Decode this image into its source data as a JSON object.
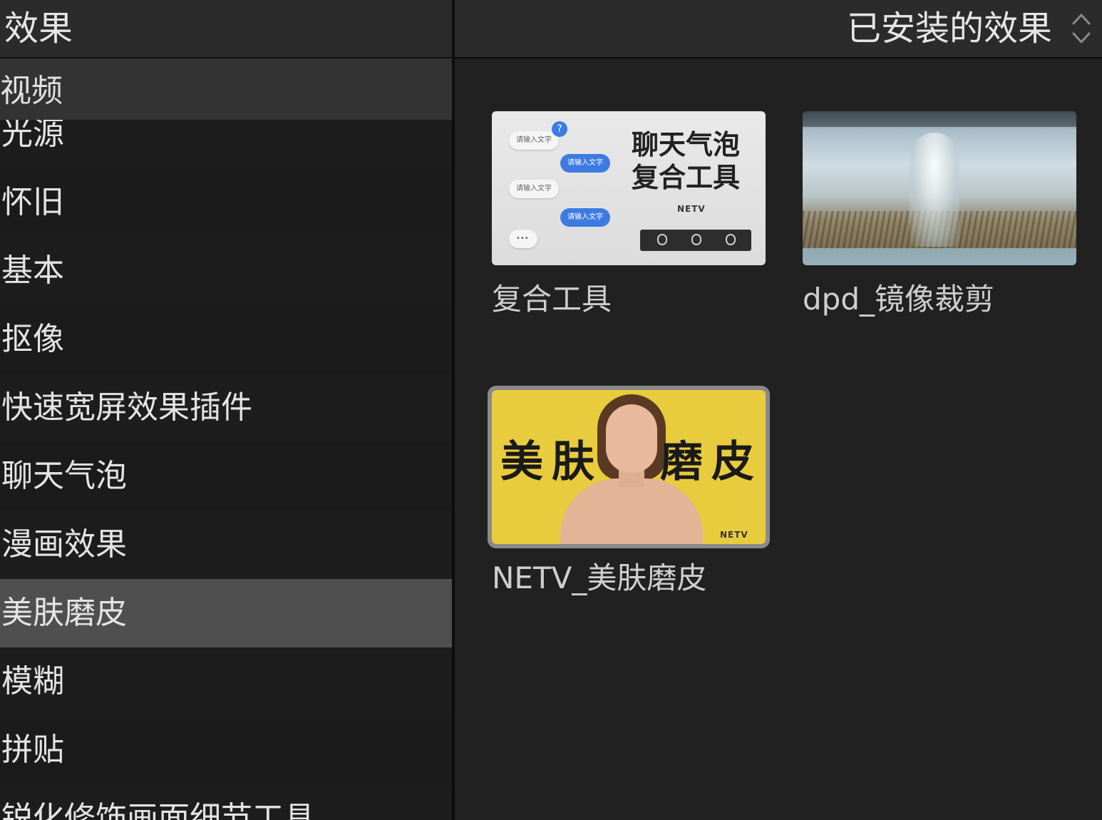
{
  "sidebar": {
    "title": "效果",
    "section": "视频",
    "categories": [
      {
        "label": "光源",
        "selected": false
      },
      {
        "label": "怀旧",
        "selected": false
      },
      {
        "label": "基本",
        "selected": false
      },
      {
        "label": "抠像",
        "selected": false
      },
      {
        "label": "快速宽屏效果插件",
        "selected": false
      },
      {
        "label": "聊天气泡",
        "selected": false
      },
      {
        "label": "漫画效果",
        "selected": false
      },
      {
        "label": "美肤磨皮",
        "selected": true
      },
      {
        "label": "模糊",
        "selected": false
      },
      {
        "label": "拼贴",
        "selected": false
      },
      {
        "label": "锐化修饰画面细节工具",
        "selected": false
      }
    ]
  },
  "header": {
    "filter_label": "已安装的效果",
    "filter_icon": "updown-chevron-icon"
  },
  "effects": [
    {
      "name": "复合工具",
      "thumbnail": {
        "title_line1": "聊天气泡",
        "title_line2": "复合工具",
        "brand": "NETV",
        "bubble_text": "请输入文字",
        "question": "?"
      }
    },
    {
      "name": "dpd_镜像裁剪",
      "thumbnail": {}
    },
    {
      "name": "NETV_美肤磨皮",
      "selected": true,
      "thumbnail": {
        "text_left": "美肤",
        "text_right": "磨皮",
        "brand": "NETV"
      }
    }
  ],
  "colors": {
    "sidebar_selected": "#4f4f4f",
    "panel_bg": "#212121",
    "skin_thumb_bg": "#e9cc3d",
    "chat_bubble_blue": "#3d7be3"
  }
}
